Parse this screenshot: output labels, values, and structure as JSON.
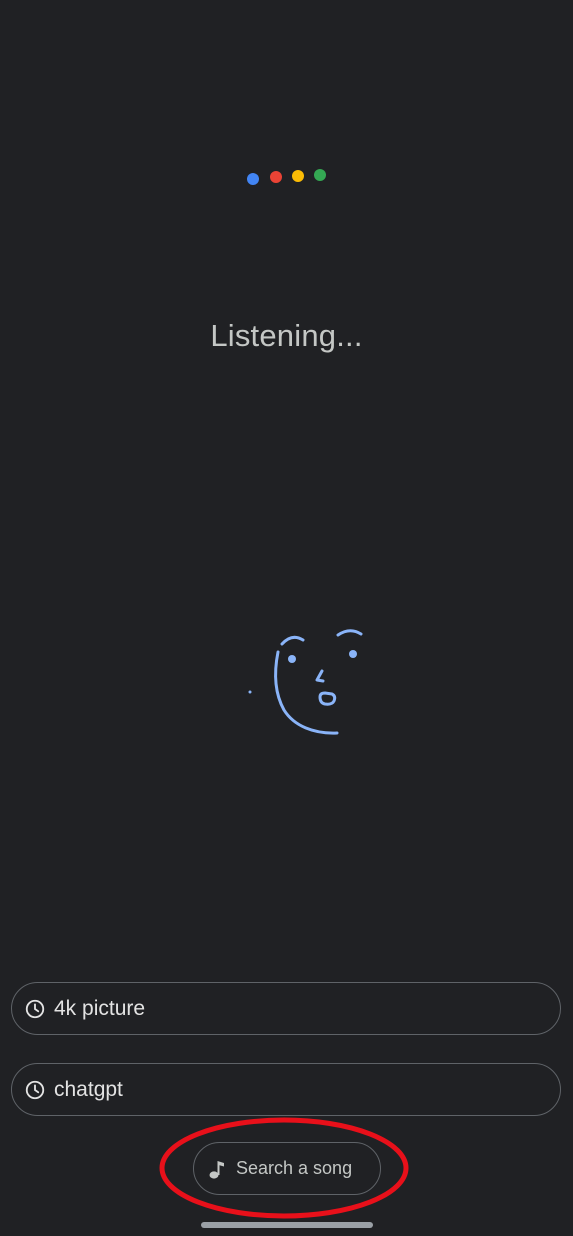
{
  "assistant": {
    "status_text": "Listening...",
    "dots": [
      {
        "name": "blue",
        "color": "#4285f4"
      },
      {
        "name": "red",
        "color": "#ea4335"
      },
      {
        "name": "yellow",
        "color": "#fbbc05"
      },
      {
        "name": "green",
        "color": "#34a853"
      }
    ],
    "animation_icon": "face-doodle-icon",
    "animation_color": "#8ab4f8"
  },
  "suggestions": [
    {
      "icon": "history-clock-icon",
      "label": "4k picture"
    },
    {
      "icon": "history-clock-icon",
      "label": "chatgpt"
    }
  ],
  "song_search": {
    "icon": "music-note-icon",
    "label": "Search a song",
    "annotation_color": "#e8101a"
  },
  "colors": {
    "background": "#202124",
    "accent": "#8ab4f8",
    "chip_border": "#5f6368"
  }
}
